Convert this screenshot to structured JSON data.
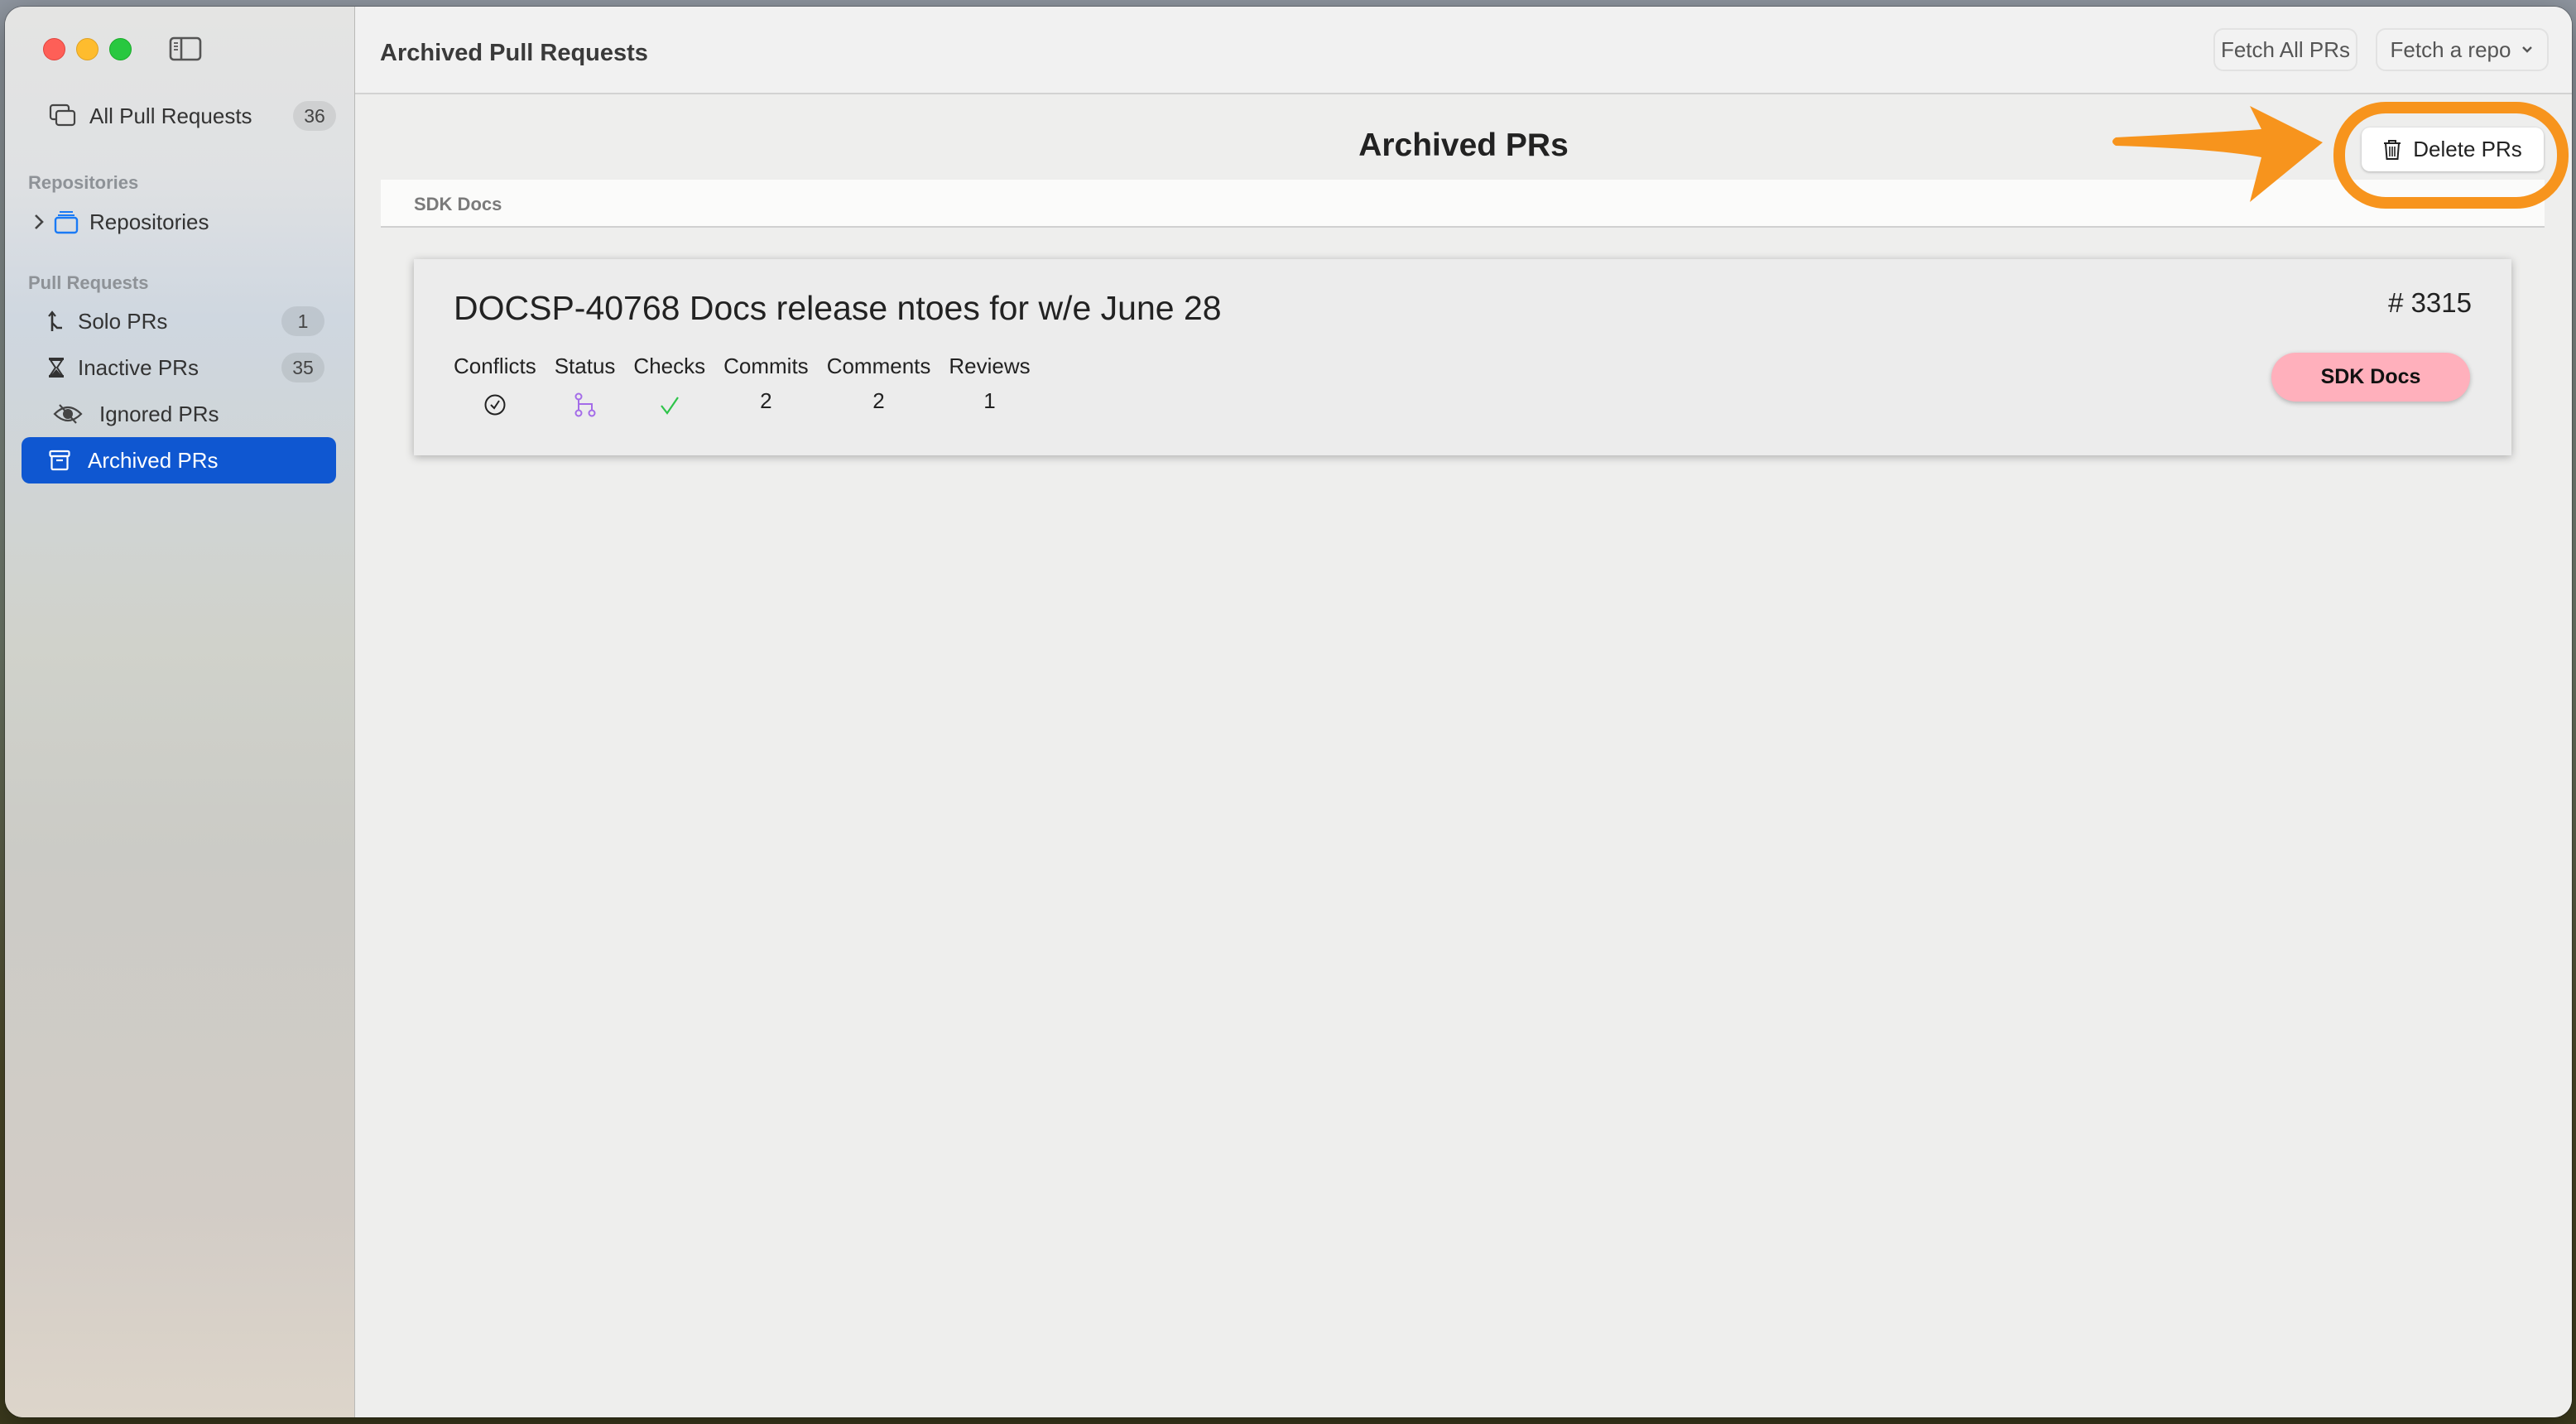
{
  "window": {
    "toolbar_title": "Archived Pull Requests",
    "buttons": {
      "fetch_all": "Fetch All PRs",
      "fetch_repo": "Fetch a repo"
    }
  },
  "sidebar": {
    "all_pull_requests": {
      "label": "All Pull Requests",
      "count": "36",
      "icon": "stacked-windows-icon"
    },
    "repositories_section": "Repositories",
    "repositories_item": {
      "label": "Repositories",
      "icon": "folder-stack-icon",
      "expanded": false
    },
    "pull_requests_section": "Pull Requests",
    "items": [
      {
        "label": "Solo PRs",
        "count": "1",
        "icon": "walking-figure-icon",
        "selected": false
      },
      {
        "label": "Inactive PRs",
        "count": "35",
        "icon": "hourglass-icon",
        "selected": false
      },
      {
        "label": "Ignored PRs",
        "count": null,
        "icon": "eye-slash-icon",
        "selected": false
      },
      {
        "label": "Archived PRs",
        "count": null,
        "icon": "archive-box-icon",
        "selected": true
      }
    ]
  },
  "main": {
    "heading": "Archived PRs",
    "delete_button": {
      "label": "Delete PRs",
      "icon": "trash-icon"
    },
    "groups": [
      {
        "name": "SDK Docs",
        "prs": [
          {
            "title": "DOCSP-40768 Docs release ntoes for w/e June 28",
            "number": "# 3315",
            "repo_badge": "SDK Docs",
            "metrics": [
              {
                "label": "Conflicts",
                "value": "no-conflicts",
                "icon": "checkmark-circle-icon"
              },
              {
                "label": "Status",
                "value": "merged",
                "icon": "merge-branch-icon"
              },
              {
                "label": "Checks",
                "value": "passed",
                "icon": "checkmark-icon"
              },
              {
                "label": "Commits",
                "value": "2"
              },
              {
                "label": "Comments",
                "value": "2"
              },
              {
                "label": "Reviews",
                "value": "1"
              }
            ]
          }
        ]
      }
    ]
  },
  "colors": {
    "accent_selected": "#0f57d1",
    "annotation": "#f7941d",
    "repo_badge": "#ffb0bc",
    "merged": "#a46ce8",
    "checks_passed": "#2ec44a"
  }
}
